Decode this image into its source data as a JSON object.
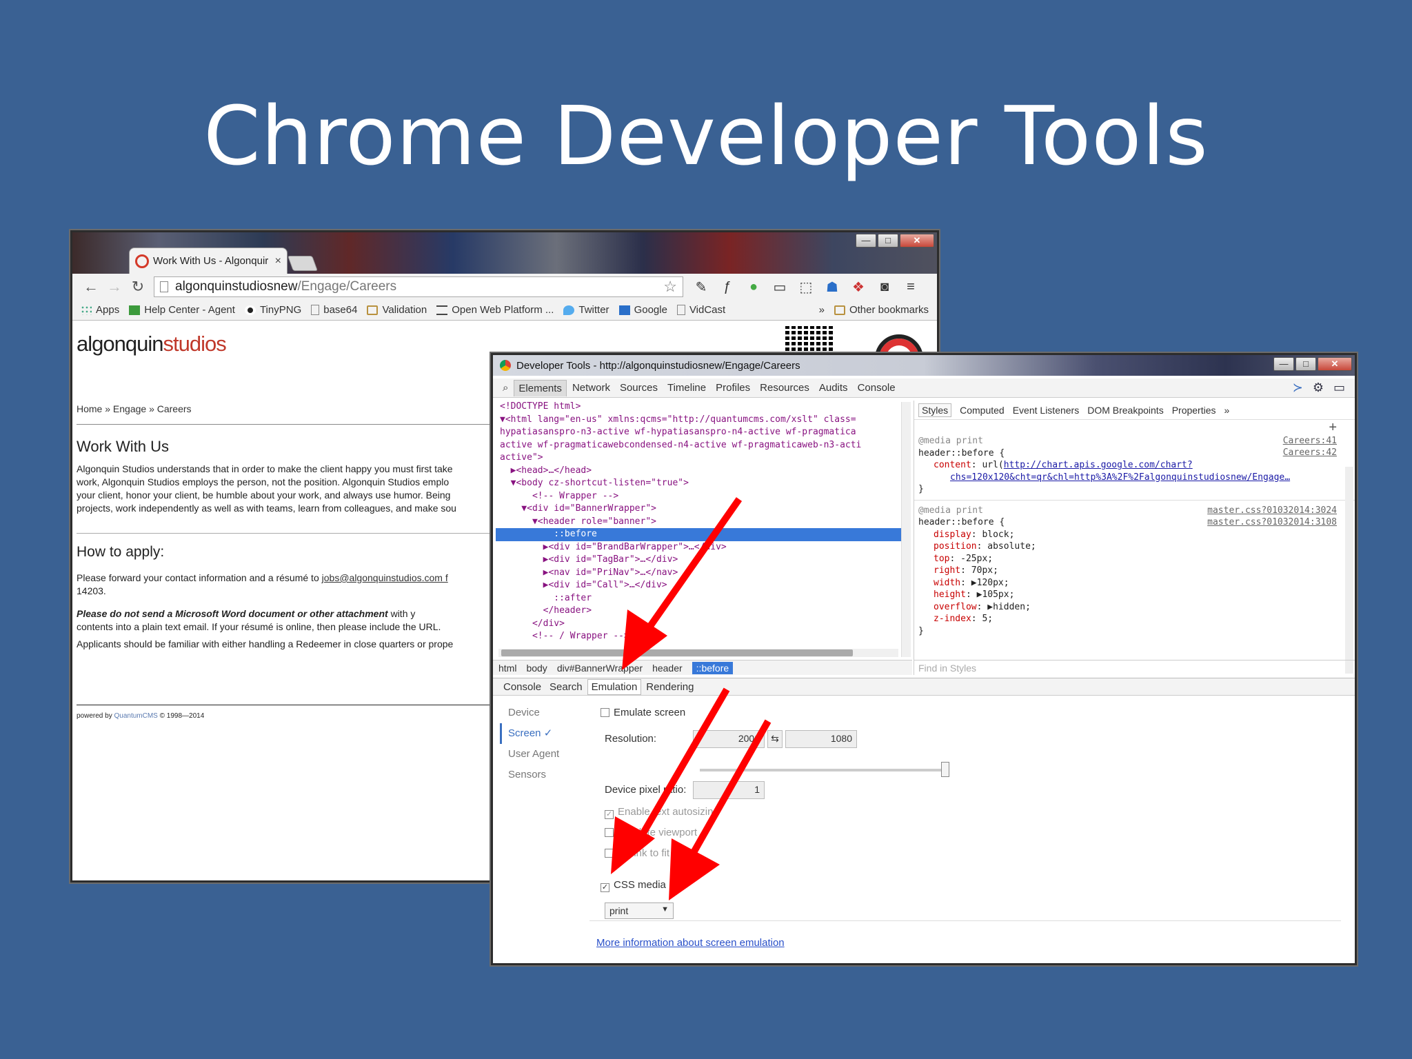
{
  "slide": {
    "title": "Chrome Developer Tools"
  },
  "browser": {
    "tab_title": "Work With Us - Algonquir",
    "tab_close": "×",
    "url_host": "algonquinstudiosnew",
    "url_path": "/Engage/Careers",
    "bookmarks": [
      "Apps",
      "Help Center - Agent",
      "TinyPNG",
      "base64",
      "Validation",
      "Open Web Platform ...",
      "Twitter",
      "Google",
      "VidCast"
    ],
    "bookmarks_more": "»",
    "other_bookmarks": "Other bookmarks",
    "window_buttons": {
      "min": "—",
      "max": "□",
      "close": "✕"
    }
  },
  "site": {
    "logo_part1": "algonquin",
    "logo_part2": "studios",
    "breadcrumb": "Home » Engage » Careers",
    "heading_work": "Work With Us",
    "para1_line1": "Algonquin Studios understands that in order to make the client happy you must first take",
    "para1_line2": "work, Algonquin Studios employs the person, not the position. Algonquin Studios emplo",
    "para1_line3": "your client, honor your client, be humble about your work, and always use humor. Being",
    "para1_line4": "projects, work independently as well as with teams, learn from colleagues, and make sou",
    "heading_apply": "How to apply:",
    "apply_text": "Please forward your contact information and a résumé to ",
    "apply_email": "jobs@algonquinstudios.com f",
    "apply_zip": "14203.",
    "warning_bold": "Please do not send a Microsoft Word document or other attachment",
    "warning_rest": " with y",
    "warning_line2": "contents into a plain text email. If your résumé is online, then please include the URL.",
    "applicants": "Applicants should be familiar with either handling a Redeemer in close quarters or prope",
    "footer_pre": "powered by ",
    "footer_brand": "QuantumCMS",
    "footer_post": " © 1998—2014"
  },
  "devtools": {
    "title": "Developer Tools - http://algonquinstudiosnew/Engage/Careers",
    "tabs": [
      "Elements",
      "Network",
      "Sources",
      "Timeline",
      "Profiles",
      "Resources",
      "Audits",
      "Console"
    ],
    "active_tab": "Elements",
    "code_lines": [
      "<!DOCTYPE html>",
      "▼<html lang=\"en-us\" xmlns:qcms=\"http://quantumcms.com/xslt\" class=",
      "hypatiasanspro-n3-active wf-hypatiasanspro-n4-active wf-pragmatica",
      "active wf-pragmaticawebcondensed-n4-active wf-pragmaticaweb-n3-acti",
      "active\">",
      "  ▶<head>…</head>",
      "  ▼<body cz-shortcut-listen=\"true\">",
      "      <!-- Wrapper -->",
      "    ▼<div id=\"BannerWrapper\">",
      "      ▼<header role=\"banner\">",
      "          ::before",
      "        ▶<div id=\"BrandBarWrapper\">…</div>",
      "        ▶<div id=\"TagBar\">…</div>",
      "        ▶<nav id=\"PriNav\">…</nav>",
      "        ▶<div id=\"Call\">…</div>",
      "          ::after",
      "        </header>",
      "      </div>",
      "      <!-- / Wrapper -->"
    ],
    "breadcrumb": [
      "html",
      "body",
      "div#BannerWrapper",
      "header",
      "::before"
    ],
    "styles_tabs": [
      "Styles",
      "Computed",
      "Event Listeners",
      "DOM Breakpoints",
      "Properties",
      "»"
    ],
    "styles_add": "+",
    "css1": {
      "media": "@media print",
      "selector": "header::before {",
      "prop": "content",
      "value_prefix": "url(",
      "url1": "http://chart.apis.google.com/chart?",
      "url2": "chs=120x120&cht=qr&chl=http%3A%2F%2Falgonquinstudiosnew/Engage…",
      "src1": "Careers:41",
      "src2": "Careers:42",
      "close": "}"
    },
    "css2": {
      "media": "@media print",
      "selector": "header::before {",
      "src1": "master.css?01032014:3024",
      "src2": "master.css?01032014:3108",
      "props": [
        {
          "name": "display",
          "value": "block;"
        },
        {
          "name": "position",
          "value": "absolute;"
        },
        {
          "name": "top",
          "value": "-25px;"
        },
        {
          "name": "right",
          "value": "70px;"
        },
        {
          "name": "width",
          "value": "▶120px;"
        },
        {
          "name": "height",
          "value": "▶105px;"
        },
        {
          "name": "overflow",
          "value": "▶hidden;"
        },
        {
          "name": "z-index",
          "value": "5;"
        }
      ],
      "close": "}"
    },
    "find_in_styles": "Find in Styles",
    "drawer_tabs": [
      "Console",
      "Search",
      "Emulation",
      "Rendering"
    ],
    "drawer_active": "Emulation",
    "emulation": {
      "sidebar": [
        "Device",
        "Screen ✓",
        "User Agent",
        "Sensors"
      ],
      "sidebar_active": "Screen ✓",
      "emulate_screen": "Emulate screen",
      "resolution_label": "Resolution:",
      "res_width": "2000",
      "res_swap": "⇆",
      "res_height": "1080",
      "dpr_label": "Device pixel ratio:",
      "dpr_value": "1",
      "text_autosizing": "Enable text autosizing",
      "fit_viewport": "Emulate viewport",
      "shrink_to_fit": "Shrink to fit",
      "css_media_label": "CSS media",
      "css_media_value": "print",
      "more_info": "More information about screen emulation"
    }
  }
}
